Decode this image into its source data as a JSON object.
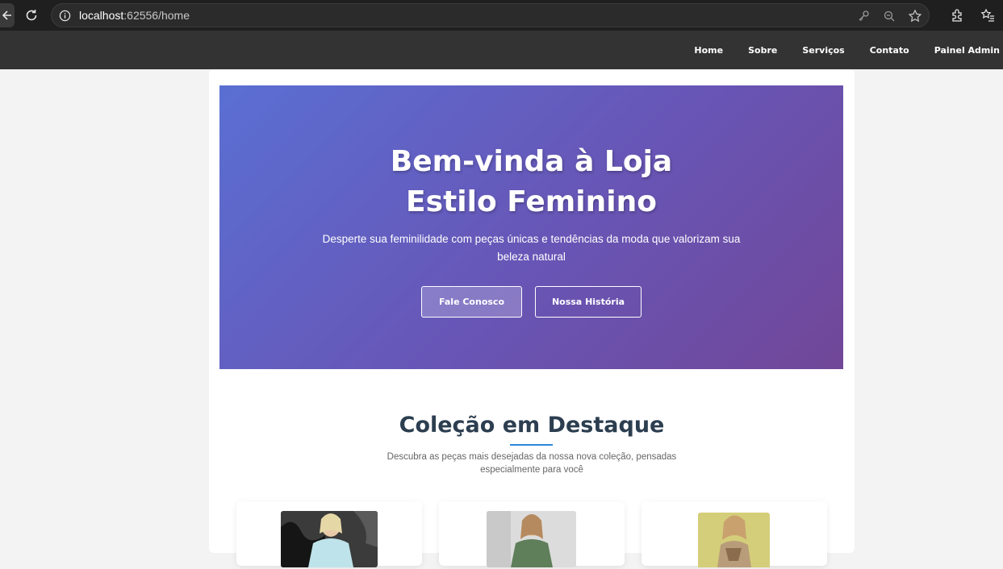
{
  "browser": {
    "url_host": "localhost",
    "url_rest": ":62556/home"
  },
  "nav": {
    "items": [
      "Home",
      "Sobre",
      "Serviços",
      "Contato",
      "Painel Admin"
    ]
  },
  "hero": {
    "title": "Bem-vinda à Loja Estilo Feminino",
    "subtitle": "Desperte sua feminilidade com peças únicas e tendências da moda que valorizam sua beleza natural",
    "btn_contact": "Fale Conosco",
    "btn_story": "Nossa História"
  },
  "featured": {
    "title": "Coleção em Destaque",
    "description": "Descubra as peças mais desejadas da nossa nova coleção, pensadas especialmente para você"
  },
  "colors": {
    "accent": "#2e86de",
    "nav_bg": "#333333",
    "hero_start": "#5a6fd3",
    "hero_end": "#714798"
  }
}
